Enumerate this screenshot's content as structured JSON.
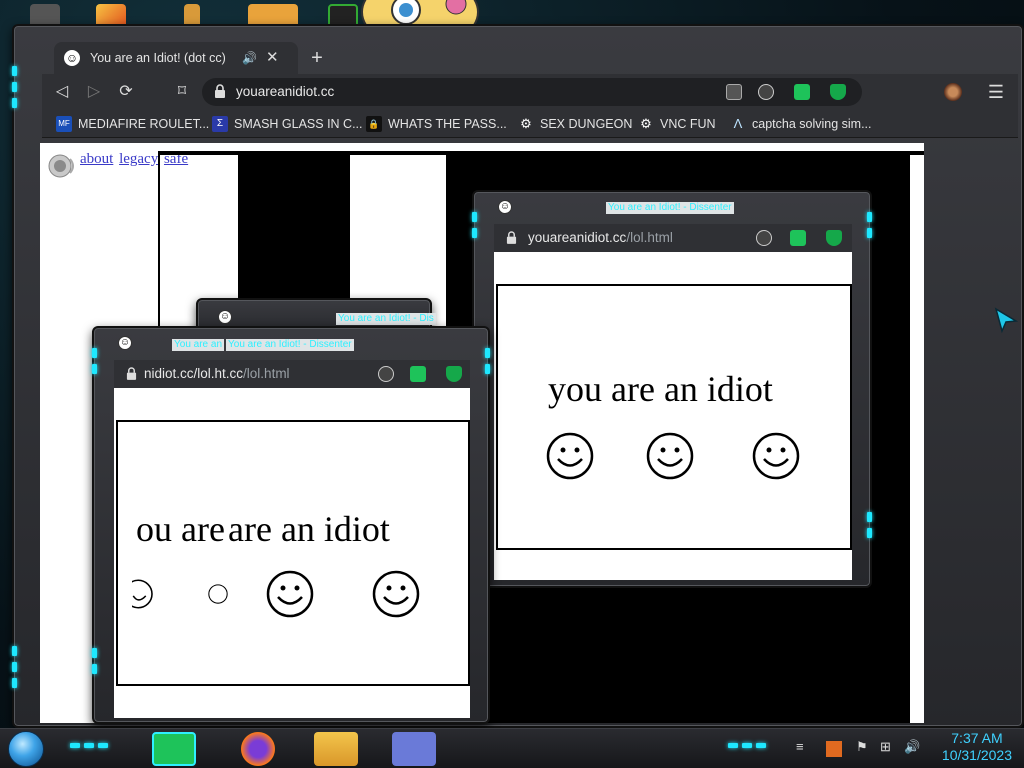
{
  "browser": {
    "tab_title": "You are an Idiot! (dot cc)",
    "new_tab_symbol": "+",
    "url": "youareanidiot.cc",
    "bookmarks": [
      {
        "label": "MEDIAFIRE ROULET...",
        "icon": "mediafire-icon",
        "icon_text": "MF"
      },
      {
        "label": "SMASH GLASS IN C...",
        "icon": "sigma-icon",
        "icon_text": "Σ"
      },
      {
        "label": "WHATS THE PASS...",
        "icon": "lock-icon",
        "icon_text": "🔒"
      },
      {
        "label": "SEX DUNGEON",
        "icon": "steam-icon",
        "icon_text": "⚙"
      },
      {
        "label": "VNC FUN",
        "icon": "steam-icon",
        "icon_text": "⚙"
      },
      {
        "label": "captcha solving sim...",
        "icon": "arc-icon",
        "icon_text": "Λ"
      }
    ]
  },
  "page": {
    "links": [
      "about",
      "legacy",
      "safe"
    ]
  },
  "popups": [
    {
      "title": "You are an Idiot! - Dissenter",
      "url_main": "youareanidiot.cc",
      "url_path": "/lol.html",
      "text": "you are an idiot"
    },
    {
      "title": "You are an Idiot! - Dissenter",
      "title_ghost": "You are an",
      "url_main": "nidiot.cc/lol.ht.cc",
      "url_path": "/lol.html",
      "text_left": "ou are",
      "text_right": "are an idiot"
    },
    {
      "title": "You are an Idiot! - Dis"
    }
  ],
  "taskbar": {
    "time": "7:37 AM",
    "date": "10/31/2023"
  },
  "colors": {
    "accent": "#1ee8ff",
    "frame": "#3a3b40",
    "chrome": "#2f3034"
  }
}
